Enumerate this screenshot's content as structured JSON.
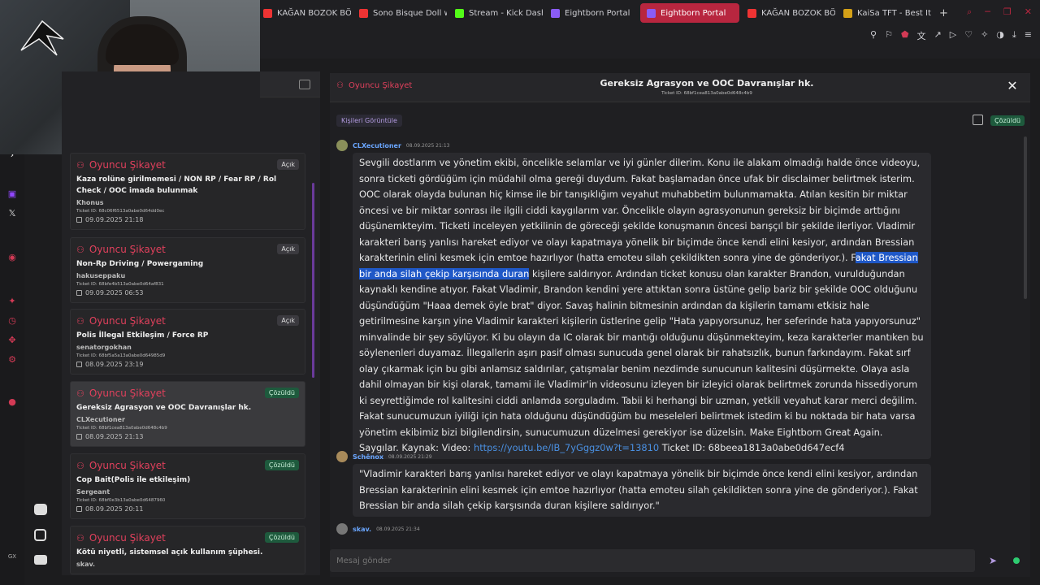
{
  "browser": {
    "tabs": [
      {
        "label": "KAĞAN BOZOK BÖLÜM",
        "color": "#e33"
      },
      {
        "label": "Sono Bisque Doll wa Ko",
        "color": "#e33"
      },
      {
        "label": "Stream - Kick Dashboard",
        "color": "#53fc18"
      },
      {
        "label": "Eightborn Portal",
        "color": "#8a5cf6"
      },
      {
        "label": "Eightborn Portal",
        "color": "#8a5cf6",
        "active": true
      },
      {
        "label": "KAĞAN BOZOK BÖLÜM",
        "color": "#e33"
      },
      {
        "label": "KaiSa TFT - Best Items",
        "color": "#d4a017"
      }
    ],
    "new_tab": "+"
  },
  "left_panel": {
    "cards": [
      {
        "category": "Oyuncu Şikayet",
        "badge": "Açık",
        "badge_type": "open",
        "title": "Kaza rolüne girilmemesi / NON RP / Fear RP / Rol Check / OOC imada bulunmak",
        "user": "Khonus",
        "ticket": "Ticket ID: 68c06f6513a0abe0d64dd0ec",
        "date": "09.09.2025 21:18"
      },
      {
        "category": "Oyuncu Şikayet",
        "badge": "Açık",
        "badge_type": "open",
        "title": "Non-Rp Driving / Powergaming",
        "user": "hakuseppaku",
        "ticket": "Ticket ID: 68bfe4b513a0abe0d64af831",
        "date": "09.09.2025 06:53"
      },
      {
        "category": "Oyuncu Şikayet",
        "badge": "Açık",
        "badge_type": "open",
        "title": "Polis İllegal Etkileşim / Force RP",
        "user": "senatorgokhan",
        "ticket": "Ticket ID: 68bf5a5a13a0abe0d64985d9",
        "date": "08.09.2025 23:19"
      },
      {
        "category": "Oyuncu Şikayet",
        "badge": "Çözüldü",
        "badge_type": "done",
        "title": "Gereksiz Agrasyon ve OOC Davranışlar hk.",
        "user": "CLXecutioner",
        "ticket": "Ticket ID: 68bf1cea813a0abe0d648c4b9",
        "date": "08.09.2025 21:13",
        "selected": true
      },
      {
        "category": "Oyuncu Şikayet",
        "badge": "Çözüldü",
        "badge_type": "done",
        "title": "Cop Bait(Polis ile etkileşim)",
        "user": "Sergeant",
        "ticket": "Ticket ID: 68bf0e3b13a0abe0d6487960",
        "date": "08.09.2025 20:11"
      },
      {
        "category": "Oyuncu Şikayet",
        "badge": "Çözüldü",
        "badge_type": "done",
        "title": "Kötü niyetli, sistemsel açık kullanım şüphesi.",
        "user": "skav.",
        "ticket": "",
        "date": ""
      }
    ]
  },
  "chat": {
    "category": "Oyuncu Şikayet",
    "title": "Gereksiz Agrasyon ve OOC Davranışlar hk.",
    "ticket": "Ticket ID: 68bf1cea813a0abe0d648c4b9",
    "people_button": "Kişileri Görüntüle",
    "status": "Çözüldü",
    "messages": [
      {
        "author": "CLXecutioner",
        "time": "08.09.2025 21:13",
        "avatar_color": "#8a8f5a",
        "text_before": "Sevgili dostlarım ve yönetim ekibi, öncelikle selamlar ve iyi günler dilerim. Konu ile alakam olmadığı halde önce videoyu, sonra ticketi gördüğüm için müdahil olma gereği duydum. Fakat başlamadan önce ufak bir disclaimer belirtmek isterim. OOC olarak olayda bulunan hiç kimse ile bir tanışıklığım veyahut muhabbetim bulunmamakta. Atılan kesitin bir miktar öncesi ve bir miktar sonrası ile ilgili ciddi kaygılarım var. Öncelikle olayın agrasyonunun gereksiz bir biçimde arttığını düşünemkteyim. Ticketi inceleyen yetkilinin de göreceği şekilde konuşmanın öncesi barışçıl bir şekilde ilerliyor. Vladimir karakteri barış yanlısı hareket ediyor ve olayı kapatmaya yönelik bir biçimde önce kendi elini kesiyor, ardından Bressian karakterinin elini kesmek için emtoe hazırlıyor (hatta emoteu silah çekildikten sonra yine de gönderiyor.). F",
        "text_highlight": "akat Bressian bir anda silah çekip karşısında duran",
        "text_after": " kişilere saldırıyor. Ardından ticket konusu olan karakter Brandon, vurulduğundan kaynaklı kendine atıyor. Fakat Vladimir, Brandon kendini yere attıktan sonra üstüne gelip bariz bir şekilde OOC olduğunu düşündüğüm \"Haaa demek öyle brat\" diyor. Savaş halinin bitmesinin ardından da kişilerin tamamı etkisiz hale getirilmesine karşın yine Vladimir karakteri kişilerin üstlerine gelip \"Hata yapıyorsunuz, her seferinde hata yapıyorsunuz\" minvalinde bir şey söylüyor. Ki bu olayın da IC olarak bir mantığı olduğunu düşünmekteyim, keza karakterler mantıken bu söylenenleri duyamaz. İllegallerin aşırı pasif olması sunucuda genel olarak bir rahatsızlık, bunun farkındayım. Fakat sırf olay çıkarmak için bu gibi anlamsız saldırılar, çatışmalar benim nezdimde sunucunun kalitesini düşürmekte. Olaya asla dahil olmayan bir kişi olarak, tamami ile Vladimir'in videosunu izleyen bir izleyici olarak belirtmek zorunda hissediyorum ki seyrettiğimde rol kalitesini ciddi anlamda sorguladım. Tabii ki herhangi bir uzman, yetkili veyahut karar merci değilim. Fakat sunucumuzun iyiliği için hata olduğunu düşündüğüm bu meseleleri belirtmek istedim ki bu noktada bir hata varsa yönetim ekibimiz bizi bilgilendirsin, sunucumuzun düzelmesi gerekiyor ise düzelsin. Make Eightborn Great Again. Saygılar. Kaynak: Video: ",
        "link": "https://youtu.be/IB_7yGggz0w?t=13810",
        "text_end": " Ticket ID: 68beea1813a0abe0d647ecf4"
      },
      {
        "author": "Schênox",
        "time": "08.09.2025 21:29",
        "avatar_color": "#a88a5a",
        "text": "\"Vladimir karakteri barış yanlısı hareket ediyor ve olayı kapatmaya yönelik bir biçimde önce kendi elini kesiyor, ardından Bressian karakterinin elini kesmek için emtoe hazırlıyor (hatta emoteu silah çekildikten sonra yine de gönderiyor.). Fakat Bressian bir anda silah çekip karşısında duran kişilere saldırıyor.\""
      },
      {
        "author": "skav.",
        "time": "08.09.2025 21:34",
        "avatar_color": "#777"
      }
    ],
    "input_placeholder": "Mesaj gönder"
  },
  "colors": {
    "accent": "#e0405c",
    "resolved": "#1e5a3d",
    "link": "#4a90e2"
  }
}
